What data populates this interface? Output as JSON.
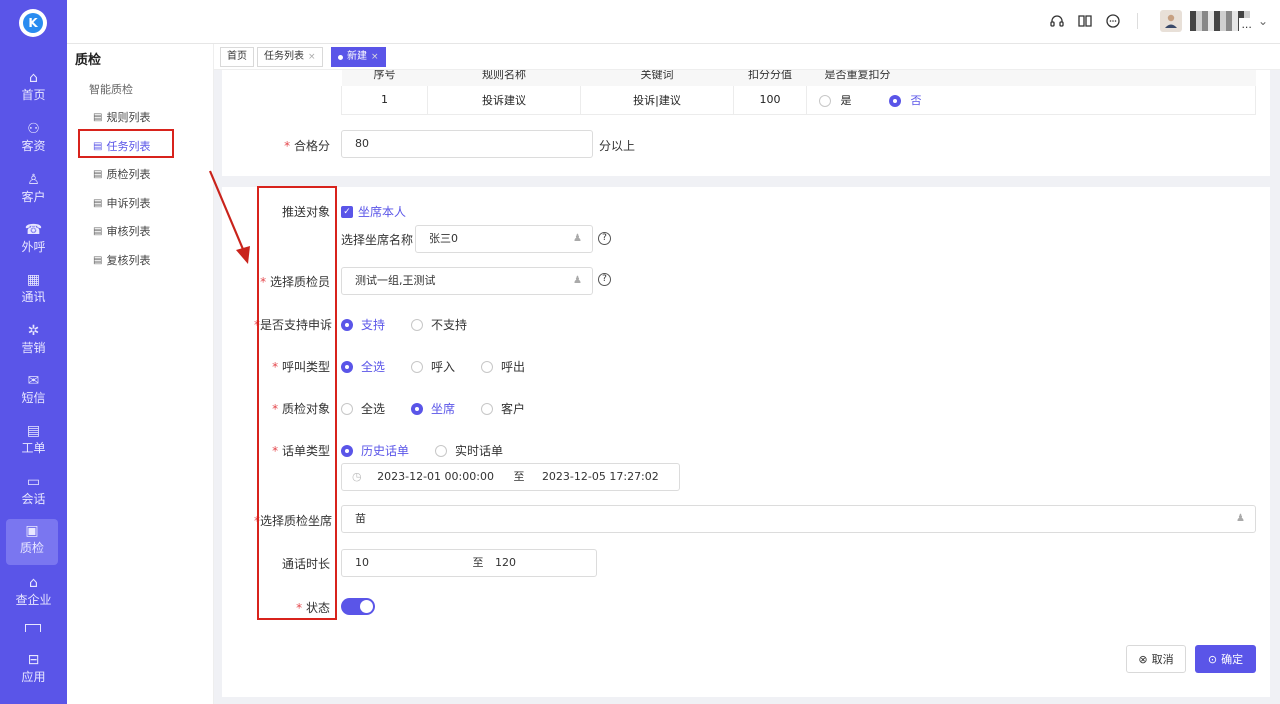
{
  "brand": {
    "logo_letter": "K",
    "accent": "#5a55e8"
  },
  "sidebar": {
    "items": [
      {
        "icon": "home-icon",
        "glyph": "⌂",
        "label": "首页"
      },
      {
        "icon": "customer-resource-icon",
        "glyph": "⚇",
        "label": "客资"
      },
      {
        "icon": "customer-icon",
        "glyph": "♙",
        "label": "客户"
      },
      {
        "icon": "outbound-call-icon",
        "glyph": "☎",
        "label": "外呼"
      },
      {
        "icon": "contacts-icon",
        "glyph": "▦",
        "label": "通讯"
      },
      {
        "icon": "marketing-icon",
        "glyph": "✲",
        "label": "营销"
      },
      {
        "icon": "sms-icon",
        "glyph": "✉",
        "label": "短信"
      },
      {
        "icon": "ticket-icon",
        "glyph": "▤",
        "label": "工单"
      },
      {
        "icon": "chat-icon",
        "glyph": "▭",
        "label": "会话"
      },
      {
        "icon": "quality-check-icon",
        "glyph": "▣",
        "label": "质检"
      },
      {
        "icon": "company-lookup-icon",
        "glyph": "⌂",
        "label": "查企业"
      },
      {
        "icon": "apps-icon",
        "glyph": "⊟",
        "label": "应用"
      }
    ]
  },
  "topbar": {
    "user_suffix": "...",
    "icons": [
      "headset-icon",
      "book-icon",
      "message-icon"
    ]
  },
  "subnav": {
    "title": "质检",
    "group": "智能质检",
    "items": [
      {
        "label": "规则列表"
      },
      {
        "label": "任务列表"
      },
      {
        "label": "质检列表"
      },
      {
        "label": "申诉列表"
      },
      {
        "label": "审核列表"
      },
      {
        "label": "复核列表"
      }
    ]
  },
  "tabs": [
    {
      "label": "首页"
    },
    {
      "label": "任务列表",
      "close": "×"
    },
    {
      "label": "新建",
      "close": "×"
    }
  ],
  "rules_table": {
    "headers": [
      "序号",
      "规则名称",
      "关键词",
      "扣分分值",
      "是否重复扣分"
    ],
    "rows": [
      {
        "index": "1",
        "name": "投诉建议",
        "keywords": "投诉|建议",
        "score": "100",
        "yes": "是",
        "no": "否",
        "repeat": "否"
      }
    ]
  },
  "pass_score": {
    "label": "合格分",
    "value": "80",
    "suffix": "分以上"
  },
  "form": {
    "push_target": {
      "label": "推送对象",
      "checkbox": "坐席本人",
      "checked": true,
      "sub_label": "选择坐席名称",
      "value": "张三0"
    },
    "inspector": {
      "label": "选择质检员",
      "value": "测试一组,王测试"
    },
    "appeal": {
      "label": "是否支持申诉",
      "options": [
        "支持",
        "不支持"
      ],
      "selected": "支持"
    },
    "call_type": {
      "label": "呼叫类型",
      "options": [
        "全选",
        "呼入",
        "呼出"
      ],
      "selected": "全选"
    },
    "target": {
      "label": "质检对象",
      "options": [
        "全选",
        "坐席",
        "客户"
      ],
      "selected": "坐席"
    },
    "record_type": {
      "label": "话单类型",
      "options": [
        "历史话单",
        "实时话单"
      ],
      "selected": "历史话单"
    },
    "date_range": {
      "start": "2023-12-01 00:00:00",
      "sep": "至",
      "end": "2023-12-05 17:27:02"
    },
    "agents": {
      "label": "选择质检坐席",
      "value": "苗"
    },
    "duration": {
      "label": "通话时长",
      "min": "10",
      "sep": "至",
      "max": "120"
    },
    "status": {
      "label": "状态",
      "enabled": true
    }
  },
  "actions": {
    "cancel": "取消",
    "confirm": "确定"
  }
}
